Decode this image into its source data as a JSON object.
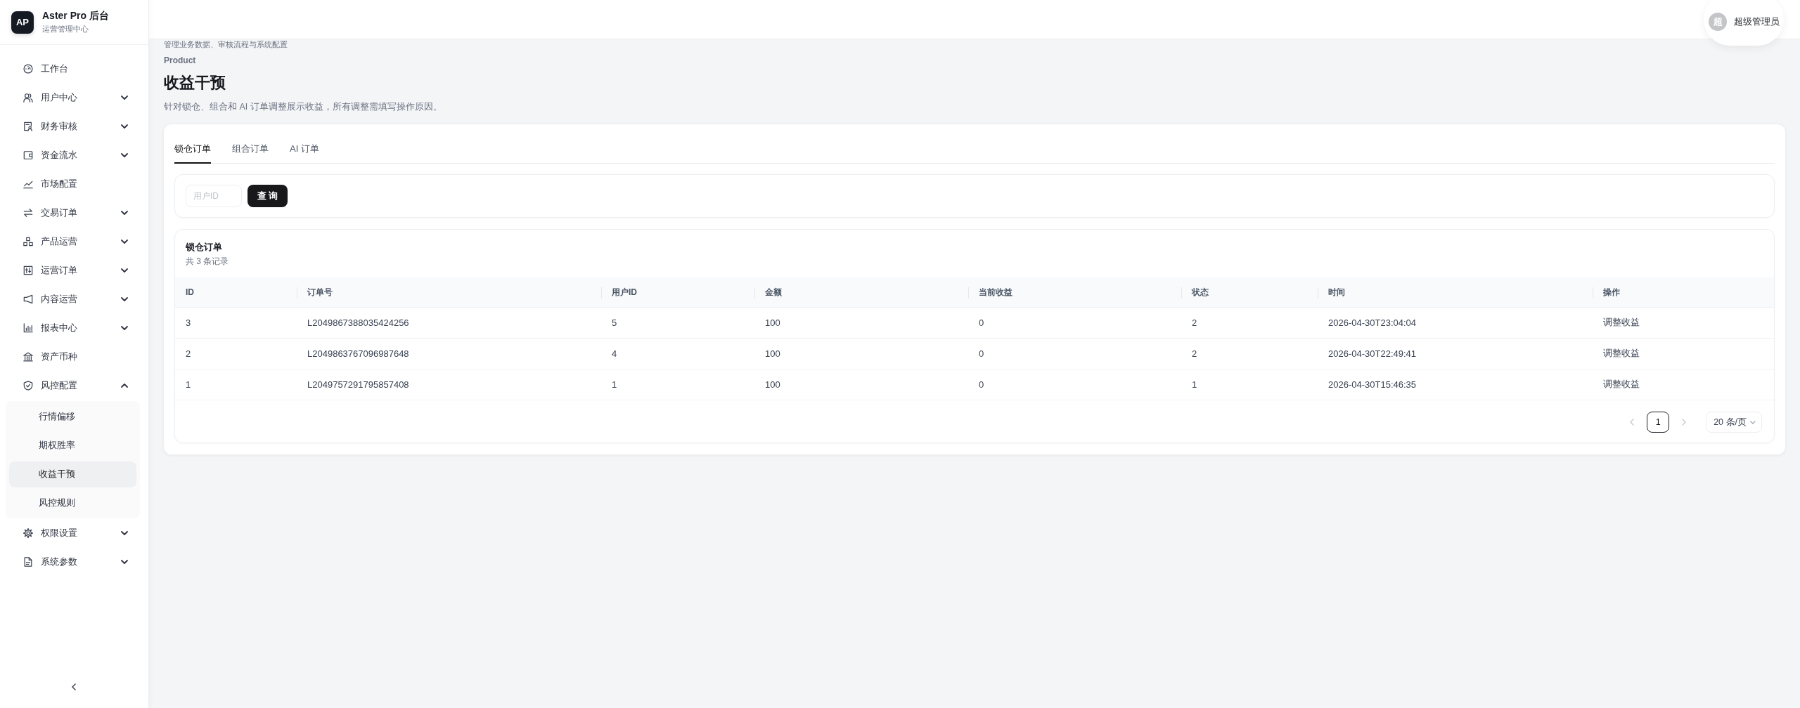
{
  "sidebar": {
    "logo": "AP",
    "title": "Aster Pro 后台",
    "subtitle": "运营管理中心",
    "items": [
      {
        "label": "工作台",
        "kind": "link",
        "selected": false
      },
      {
        "label": "用户中心",
        "kind": "group",
        "selected": false,
        "expanded": false
      },
      {
        "label": "财务审核",
        "kind": "group",
        "selected": false,
        "expanded": false
      },
      {
        "label": "资金流水",
        "kind": "group",
        "selected": false,
        "expanded": false
      },
      {
        "label": "市场配置",
        "kind": "link",
        "selected": false
      },
      {
        "label": "交易订单",
        "kind": "group",
        "selected": false,
        "expanded": false
      },
      {
        "label": "产品运营",
        "kind": "group",
        "selected": false,
        "expanded": false
      },
      {
        "label": "运营订单",
        "kind": "group",
        "selected": false,
        "expanded": false
      },
      {
        "label": "内容运营",
        "kind": "group",
        "selected": false,
        "expanded": false
      },
      {
        "label": "报表中心",
        "kind": "group",
        "selected": false,
        "expanded": false
      },
      {
        "label": "资产币种",
        "kind": "link",
        "selected": false
      },
      {
        "label": "风控配置",
        "kind": "group",
        "selected": false,
        "expanded": true,
        "children": [
          {
            "label": "行情偏移",
            "selected": false
          },
          {
            "label": "期权胜率",
            "selected": false
          },
          {
            "label": "收益干预",
            "selected": true
          },
          {
            "label": "风控规则",
            "selected": false
          }
        ]
      },
      {
        "label": "权限设置",
        "kind": "group",
        "selected": false,
        "expanded": false
      },
      {
        "label": "系统参数",
        "kind": "group",
        "selected": false,
        "expanded": false
      }
    ]
  },
  "header": {
    "user": {
      "avatar": "超",
      "name": "超级管理员"
    }
  },
  "page": {
    "subheading": "管理业务数据、审核流程与系统配置",
    "eyebrow": "Product",
    "title": "收益干预",
    "description": "针对锁仓、组合和 AI 订单调整展示收益，所有调整需填写操作原因。"
  },
  "tabs": [
    {
      "label": "锁仓订单",
      "selected": true
    },
    {
      "label": "组合订单",
      "selected": false
    },
    {
      "label": "AI 订单",
      "selected": false
    }
  ],
  "filter": {
    "placeholder": "用户ID",
    "button": "查 询"
  },
  "table": {
    "title": "锁仓订单",
    "count": "共 3 条记录",
    "columns": [
      {
        "label": "ID",
        "kind": "text"
      },
      {
        "label": "订单号",
        "kind": "text"
      },
      {
        "label": "用户ID",
        "kind": "text"
      },
      {
        "label": "金额",
        "kind": "text"
      },
      {
        "label": "当前收益",
        "kind": "text"
      },
      {
        "label": "状态",
        "kind": "text"
      },
      {
        "label": "时间",
        "kind": "text"
      },
      {
        "label": "操作",
        "kind": "action"
      }
    ],
    "rows": [
      [
        "3",
        "L2049867388035424256",
        "5",
        "100",
        "0",
        "2",
        "2026-04-30T23:04:04",
        "调整收益"
      ],
      [
        "2",
        "L2049863767096987648",
        "4",
        "100",
        "0",
        "2",
        "2026-04-30T22:49:41",
        "调整收益"
      ],
      [
        "1",
        "L2049757291795857408",
        "1",
        "100",
        "0",
        "1",
        "2026-04-30T15:46:35",
        "调整收益"
      ]
    ]
  },
  "pagination": {
    "prev": {
      "disabled": true
    },
    "pages": [
      {
        "label": "1",
        "selected": true
      }
    ],
    "next": {
      "disabled": true
    },
    "page_size": "20 条/页"
  }
}
